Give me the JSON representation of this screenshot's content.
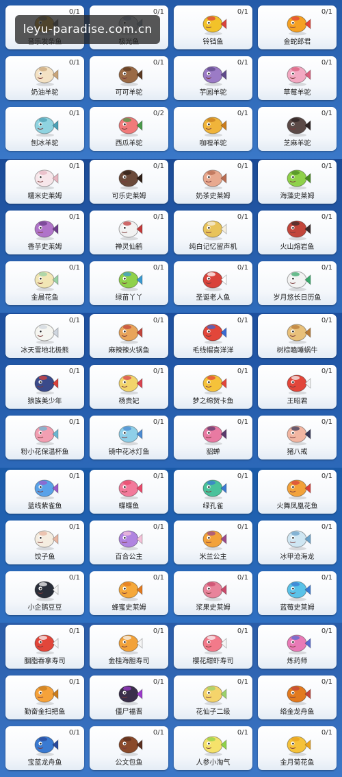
{
  "watermark": "leyu-paradise.com.cn",
  "items": [
    {
      "name": "音乐发条鱼",
      "count": "0/1",
      "icon": "fish-gold-icon",
      "color": "#d9a93b",
      "color2": "#6b6b6b"
    },
    {
      "name": "极光鱼",
      "count": "0/1",
      "icon": "fish-silver-icon",
      "color": "#cfd6df",
      "color2": "#8fa2b8"
    },
    {
      "name": "铃铛鱼",
      "count": "0/1",
      "icon": "bell-fish-icon",
      "color": "#f2c22a",
      "color2": "#d9433b"
    },
    {
      "name": "金蛇郎君",
      "count": "0/1",
      "icon": "golden-snake-fish-icon",
      "color": "#f5a123",
      "color2": "#e2463a"
    },
    {
      "name": "奶油羊驼",
      "count": "0/1",
      "icon": "alpaca-cream-icon",
      "color": "#f4e2c4",
      "color2": "#c9a57a"
    },
    {
      "name": "可可羊驼",
      "count": "0/1",
      "icon": "alpaca-cocoa-icon",
      "color": "#9a6a45",
      "color2": "#5b3a22"
    },
    {
      "name": "芋圆羊驼",
      "count": "0/1",
      "icon": "alpaca-taro-icon",
      "color": "#9b7bc6",
      "color2": "#5f4a8a"
    },
    {
      "name": "草莓羊驼",
      "count": "0/1",
      "icon": "alpaca-strawberry-icon",
      "color": "#f3a9c2",
      "color2": "#d9607d"
    },
    {
      "name": "刨冰羊驼",
      "count": "0/1",
      "icon": "alpaca-shaved-ice-icon",
      "color": "#8fd3e0",
      "color2": "#4da0b5"
    },
    {
      "name": "西瓜羊驼",
      "count": "0/2",
      "icon": "alpaca-watermelon-icon",
      "color": "#f07a7a",
      "color2": "#4a9a4a"
    },
    {
      "name": "咖喱羊驼",
      "count": "0/1",
      "icon": "alpaca-curry-icon",
      "color": "#f0b43a",
      "color2": "#c97d1f"
    },
    {
      "name": "芝麻羊驼",
      "count": "0/1",
      "icon": "alpaca-sesame-icon",
      "color": "#5b4a47",
      "color2": "#2e2424"
    },
    {
      "name": "糯米史莱姆",
      "count": "0/1",
      "icon": "slime-rice-icon",
      "color": "#f7e6ea",
      "color2": "#e7b6c1"
    },
    {
      "name": "可乐史莱姆",
      "count": "0/1",
      "icon": "slime-cola-icon",
      "color": "#6b4a3a",
      "color2": "#2f2018"
    },
    {
      "name": "奶茶史莱姆",
      "count": "0/1",
      "icon": "slime-milktea-icon",
      "color": "#e8a98f",
      "color2": "#b86c52"
    },
    {
      "name": "海藻史莱姆",
      "count": "0/1",
      "icon": "slime-seaweed-icon",
      "color": "#8fd14a",
      "color2": "#4a8a22"
    },
    {
      "name": "香芋史莱姆",
      "count": "0/1",
      "icon": "slime-taro-icon",
      "color": "#b074c9",
      "color2": "#6d3d8a"
    },
    {
      "name": "禅灵仙鹤",
      "count": "0/1",
      "icon": "crane-icon",
      "color": "#f2f2f2",
      "color2": "#c23a3a"
    },
    {
      "name": "纯白记忆留声机",
      "count": "0/1",
      "icon": "gramophone-icon",
      "color": "#e8c35a",
      "color2": "#f5efe0"
    },
    {
      "name": "火山熔岩鱼",
      "count": "0/1",
      "icon": "lava-fish-icon",
      "color": "#c2463b",
      "color2": "#3b2b2b"
    },
    {
      "name": "金晨花鱼",
      "count": "0/1",
      "icon": "flower-fish-icon",
      "color": "#f2e6b5",
      "color2": "#9ad1a5"
    },
    {
      "name": "绿苗丫丫",
      "count": "0/1",
      "icon": "sprout-fish-icon",
      "color": "#8fd14a",
      "color2": "#3a9ad1"
    },
    {
      "name": "圣诞老人鱼",
      "count": "0/1",
      "icon": "santa-fish-icon",
      "color": "#d9433b",
      "color2": "#ffffff"
    },
    {
      "name": "岁月悠长日历鱼",
      "count": "0/1",
      "icon": "calendar-fish-icon",
      "color": "#f2f2f2",
      "color2": "#3aa86b"
    },
    {
      "name": "冰天雪地北极熊",
      "count": "0/1",
      "icon": "polar-bear-icon",
      "color": "#f5f5f0",
      "color2": "#cfd6df"
    },
    {
      "name": "麻辣辣火锅鱼",
      "count": "0/1",
      "icon": "hotpot-fish-icon",
      "color": "#e8a45a",
      "color2": "#c2463b"
    },
    {
      "name": "毛线帽喜洋洋",
      "count": "0/1",
      "icon": "knit-hat-fish-icon",
      "color": "#e2463a",
      "color2": "#3a6ad1"
    },
    {
      "name": "树棕瞌睡蜗牛",
      "count": "0/1",
      "icon": "snail-icon",
      "color": "#e8c07a",
      "color2": "#b87c3a"
    },
    {
      "name": "狼族美少年",
      "count": "0/1",
      "icon": "wolf-boy-icon",
      "color": "#3a4a8a",
      "color2": "#d9433b"
    },
    {
      "name": "杨贵妃",
      "count": "0/1",
      "icon": "consort-icon",
      "color": "#f2d46b",
      "color2": "#d9434f"
    },
    {
      "name": "梦之绵贺卡鱼",
      "count": "0/1",
      "icon": "greeting-card-fish-icon",
      "color": "#f5c23a",
      "color2": "#e2463a"
    },
    {
      "name": "王昭君",
      "count": "0/1",
      "icon": "wang-zhaojun-icon",
      "color": "#e2463a",
      "color2": "#f2f2f2"
    },
    {
      "name": "粉小花保温杯鱼",
      "count": "0/1",
      "icon": "thermos-fish-icon",
      "color": "#f29fb2",
      "color2": "#6bb6d1"
    },
    {
      "name": "镜中花冰灯鱼",
      "count": "0/1",
      "icon": "ice-lantern-fish-icon",
      "color": "#8fcfe8",
      "color2": "#4a8ad1"
    },
    {
      "name": "貂蝉",
      "count": "0/1",
      "icon": "diaochan-icon",
      "color": "#e87aa2",
      "color2": "#5a3a6b"
    },
    {
      "name": "猪八戒",
      "count": "0/1",
      "icon": "zhubajie-icon",
      "color": "#f2b6a2",
      "color2": "#3a3a5a"
    },
    {
      "name": "蓝线紫雀鱼",
      "count": "0/1",
      "icon": "blue-purple-fish-icon",
      "color": "#5aa2e8",
      "color2": "#9b5ac9"
    },
    {
      "name": "蝶蝶鱼",
      "count": "0/1",
      "icon": "butterfly-fish-icon",
      "color": "#f27a9b",
      "color2": "#e84a6b"
    },
    {
      "name": "绿孔雀",
      "count": "0/1",
      "icon": "peacock-fish-icon",
      "color": "#4ac29b",
      "color2": "#3a7ad1"
    },
    {
      "name": "火舞凤凰花鱼",
      "count": "0/1",
      "icon": "phoenix-fish-icon",
      "color": "#f2a23a",
      "color2": "#d9433b"
    },
    {
      "name": "饺子鱼",
      "count": "0/1",
      "icon": "dumpling-fish-icon",
      "color": "#f5ede0",
      "color2": "#e8b6a2"
    },
    {
      "name": "百合公主",
      "count": "0/1",
      "icon": "lily-princess-icon",
      "color": "#b084e0",
      "color2": "#f5c2d9"
    },
    {
      "name": "米兰公主",
      "count": "0/1",
      "icon": "milan-princess-icon",
      "color": "#f2a23a",
      "color2": "#9b4a8a"
    },
    {
      "name": "冰甲沧海龙",
      "count": "0/1",
      "icon": "ice-dragon-icon",
      "color": "#cfe6f2",
      "color2": "#6ba2c9"
    },
    {
      "name": "小企鹅豆豆",
      "count": "0/1",
      "icon": "penguin-icon",
      "color": "#2a2f3a",
      "color2": "#f5f5f5"
    },
    {
      "name": "蜂蜜史莱姆",
      "count": "0/1",
      "icon": "slime-honey-icon",
      "color": "#f5a83a",
      "color2": "#e27a1f"
    },
    {
      "name": "浆果史莱姆",
      "count": "0/1",
      "icon": "slime-berry-icon",
      "color": "#e8849b",
      "color2": "#c94a6b"
    },
    {
      "name": "蓝莓史莱姆",
      "count": "0/1",
      "icon": "slime-blueberry-icon",
      "color": "#5ac2e8",
      "color2": "#3a7ad1"
    },
    {
      "name": "胭脂吞拿寿司",
      "count": "0/1",
      "icon": "tuna-sushi-icon",
      "color": "#e2463a",
      "color2": "#f5f5f5"
    },
    {
      "name": "金桂海胆寿司",
      "count": "0/1",
      "icon": "urchin-sushi-icon",
      "color": "#f2a23a",
      "color2": "#f5f5f5"
    },
    {
      "name": "樱花甜虾寿司",
      "count": "0/1",
      "icon": "shrimp-sushi-icon",
      "color": "#f27a8a",
      "color2": "#f5f5f5"
    },
    {
      "name": "炼药师",
      "count": "0/1",
      "icon": "alchemist-icon",
      "color": "#e87ab6",
      "color2": "#5a6bd1"
    },
    {
      "name": "勤奋金扫把鱼",
      "count": "0/1",
      "icon": "broom-fish-icon",
      "color": "#f5a23a",
      "color2": "#c97d1f"
    },
    {
      "name": "僵尸福晋",
      "count": "0/1",
      "icon": "zombie-lady-icon",
      "color": "#3a2f4a",
      "color2": "#9b3ac9"
    },
    {
      "name": "花仙子二级",
      "count": "0/1",
      "icon": "flower-fairy-icon",
      "color": "#f5d46b",
      "color2": "#9bd16b"
    },
    {
      "name": "络金龙舟鱼",
      "count": "0/1",
      "icon": "dragon-boat-fish-icon",
      "color": "#e27a1f",
      "color2": "#c2463b"
    },
    {
      "name": "宝蓝龙舟鱼",
      "count": "0/1",
      "icon": "blue-dragon-boat-fish-icon",
      "color": "#3a7ad1",
      "color2": "#2a4a9b"
    },
    {
      "name": "公文包鱼",
      "count": "0/1",
      "icon": "briefcase-fish-icon",
      "color": "#8a4a2a",
      "color2": "#5a2f1f"
    },
    {
      "name": "人参小淘气",
      "count": "0/1",
      "icon": "ginseng-icon",
      "color": "#f5e26b",
      "color2": "#8fd14a"
    },
    {
      "name": "金月菊花鱼",
      "count": "0/1",
      "icon": "chrysanthemum-fish-icon",
      "color": "#f5c23a",
      "color2": "#e8a21f"
    }
  ]
}
